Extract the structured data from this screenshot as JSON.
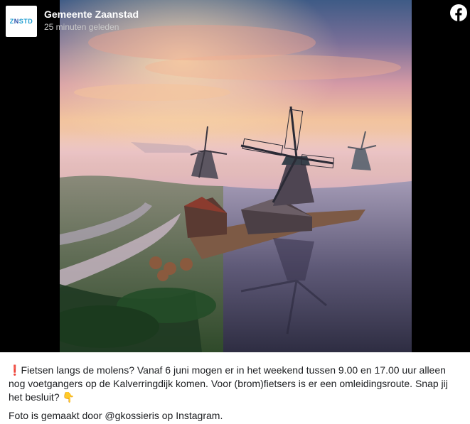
{
  "post": {
    "author": "Gemeente Zaanstad",
    "time": "25 minuten geleden",
    "avatar_text": "ZNSTD",
    "avatar_text_a": "Z",
    "avatar_text_b": "N",
    "avatar_text_c": "STD",
    "platform_icon": "facebook-icon",
    "brand_color": "#1877f2"
  },
  "caption": {
    "warning_glyph": "❗",
    "text": "Fietsen langs de molens? Vanaf 6 juni mogen er in het weekend tussen 9.00 en 17.00 uur alleen nog voetgangers op de Kalverringdijk komen. Voor (brom)fietsers is er een omleidingsroute. Snap jij het besluit?",
    "pointing_glyph": "👇",
    "credit": "Foto is gemaakt door @gkossieris op Instagram."
  },
  "photo": {
    "subject": "windmills-at-sunrise"
  }
}
